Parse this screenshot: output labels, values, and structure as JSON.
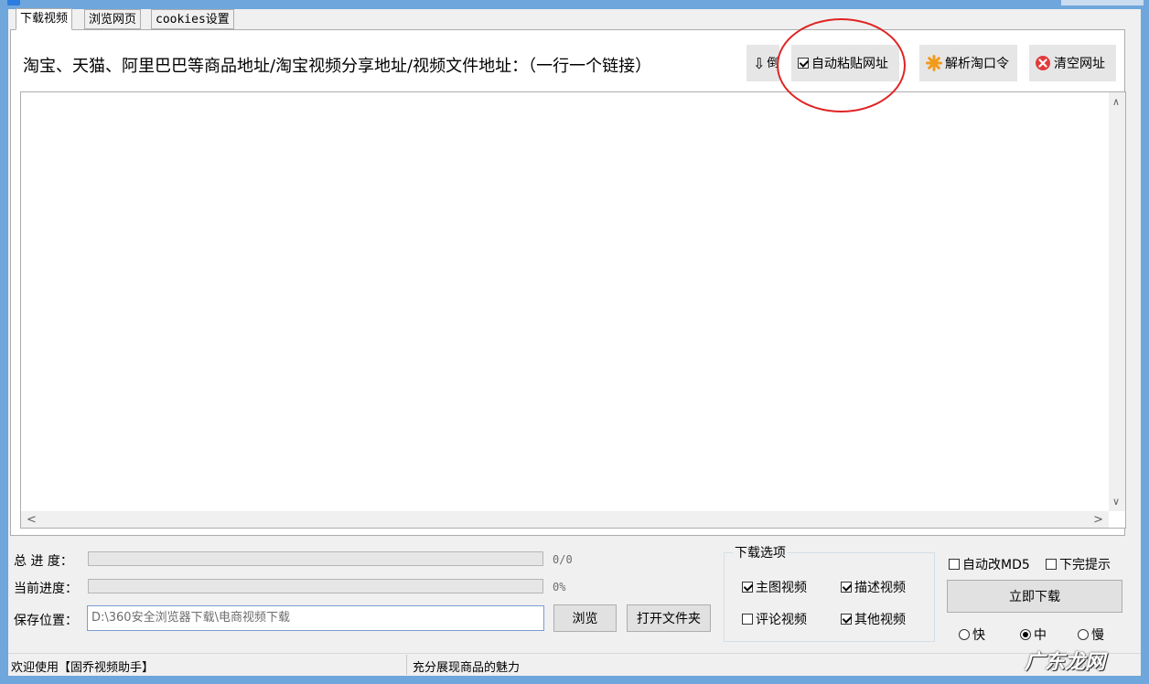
{
  "tabs": [
    {
      "label": "下载视频"
    },
    {
      "label": "浏览网页"
    },
    {
      "label": "cookies设置"
    }
  ],
  "instruction": "淘宝、天猫、阿里巴巴等商品地址/淘宝视频分享地址/视频文件地址：（一行一个链接）",
  "toolbar": {
    "sort_label": "倒序",
    "sort_icon": "down-arrow-icon",
    "auto_paste_label": "自动粘贴网址",
    "auto_paste_checked": true,
    "parse_label": "解析淘口令",
    "parse_icon": "star-icon",
    "clear_label": "清空网址",
    "clear_icon": "close-circle-icon"
  },
  "url_input": {
    "value": ""
  },
  "progress": {
    "total_label": "总 进 度：",
    "total_text": "0/0",
    "total_fraction": 0,
    "current_label": "当前进度：",
    "current_text": "0%",
    "current_fraction": 0
  },
  "save": {
    "label": "保存位置：",
    "path": "D:\\360安全浏览器下载\\电商视频下载",
    "browse_label": "浏览",
    "open_folder_label": "打开文件夹"
  },
  "download_options": {
    "title": "下载选项",
    "main_video": {
      "label": "主图视频",
      "checked": true
    },
    "desc_video": {
      "label": "描述视频",
      "checked": true
    },
    "comment_video": {
      "label": "评论视频",
      "checked": false
    },
    "other_video": {
      "label": "其他视频",
      "checked": true
    }
  },
  "right_panel": {
    "auto_md5": {
      "label": "自动改MD5",
      "checked": false
    },
    "done_tip": {
      "label": "下完提示",
      "checked": false
    },
    "download_button": "立即下载",
    "speed": {
      "fast": "快",
      "medium": "中",
      "slow": "慢",
      "selected": "medium"
    }
  },
  "status": {
    "left": "欢迎使用【固乔视频助手】",
    "right": "充分展现商品的魅力"
  },
  "watermark": "广东龙网",
  "colors": {
    "frame": "#6fa6dc",
    "annotation_circle": "#e02424",
    "input_border": "#7a9cd3"
  }
}
